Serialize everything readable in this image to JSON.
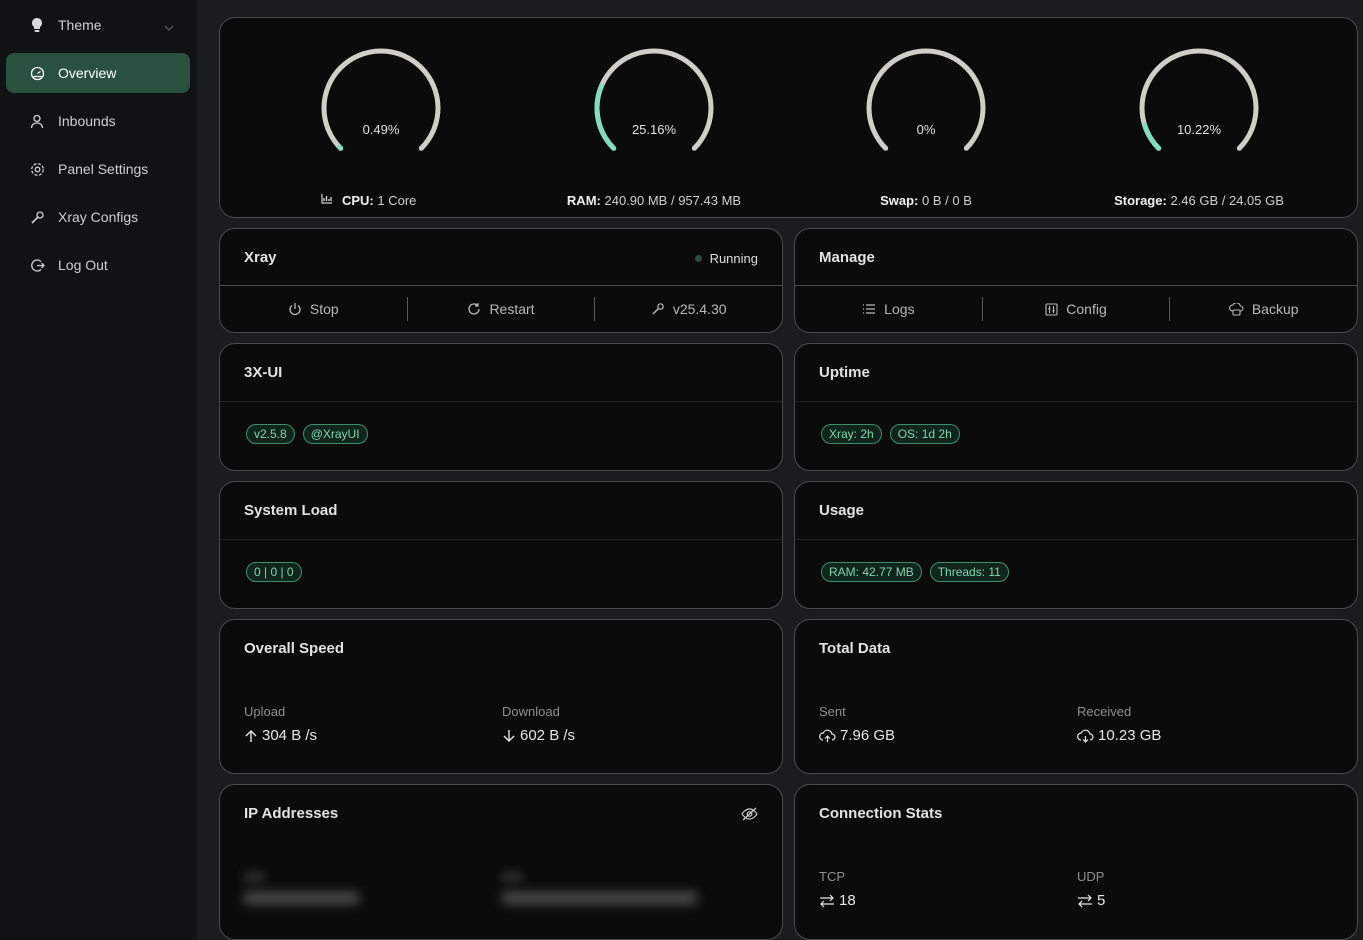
{
  "sidebar": {
    "items": [
      {
        "label": "Theme",
        "icon": "bulb-icon"
      },
      {
        "label": "Overview",
        "icon": "dashboard-icon"
      },
      {
        "label": "Inbounds",
        "icon": "user-icon"
      },
      {
        "label": "Panel Settings",
        "icon": "gear-icon"
      },
      {
        "label": "Xray Configs",
        "icon": "wrench-icon"
      },
      {
        "label": "Log Out",
        "icon": "logout-icon"
      }
    ]
  },
  "gauges": [
    {
      "percent": "0.49%",
      "value": 0.49,
      "label": "CPU:",
      "detail": "1 Core"
    },
    {
      "percent": "25.16%",
      "value": 25.16,
      "label": "RAM:",
      "detail": "240.90 MB / 957.43 MB"
    },
    {
      "percent": "0%",
      "value": 0,
      "label": "Swap:",
      "detail": "0 B / 0 B"
    },
    {
      "percent": "10.22%",
      "value": 10.22,
      "label": "Storage:",
      "detail": "2.46 GB / 24.05 GB"
    }
  ],
  "colors": {
    "accent": "#7fe0c0",
    "track": "#cfcfc8",
    "active_nav": "#2a5040"
  },
  "xray": {
    "title": "Xray",
    "status": "Running",
    "stop": "Stop",
    "restart": "Restart",
    "version": "v25.4.30"
  },
  "manage": {
    "title": "Manage",
    "logs": "Logs",
    "config": "Config",
    "backup": "Backup"
  },
  "panel": {
    "title": "3X-UI",
    "tags": [
      "v2.5.8",
      "@XrayUI"
    ]
  },
  "uptime": {
    "title": "Uptime",
    "tags": [
      "Xray: 2h",
      "OS: 1d 2h"
    ]
  },
  "system_load": {
    "title": "System Load",
    "tags": [
      "0 | 0 | 0"
    ]
  },
  "usage": {
    "title": "Usage",
    "tags": [
      "RAM: 42.77 MB",
      "Threads: 11"
    ]
  },
  "speed": {
    "title": "Overall Speed",
    "upload_label": "Upload",
    "upload_value": "304 B /s",
    "download_label": "Download",
    "download_value": "602 B /s"
  },
  "total_data": {
    "title": "Total Data",
    "sent_label": "Sent",
    "sent_value": "7.96 GB",
    "received_label": "Received",
    "received_value": "10.23 GB"
  },
  "ip": {
    "title": "IP Addresses"
  },
  "connections": {
    "title": "Connection Stats",
    "tcp_label": "TCP",
    "tcp_value": "18",
    "udp_label": "UDP",
    "udp_value": "5"
  }
}
